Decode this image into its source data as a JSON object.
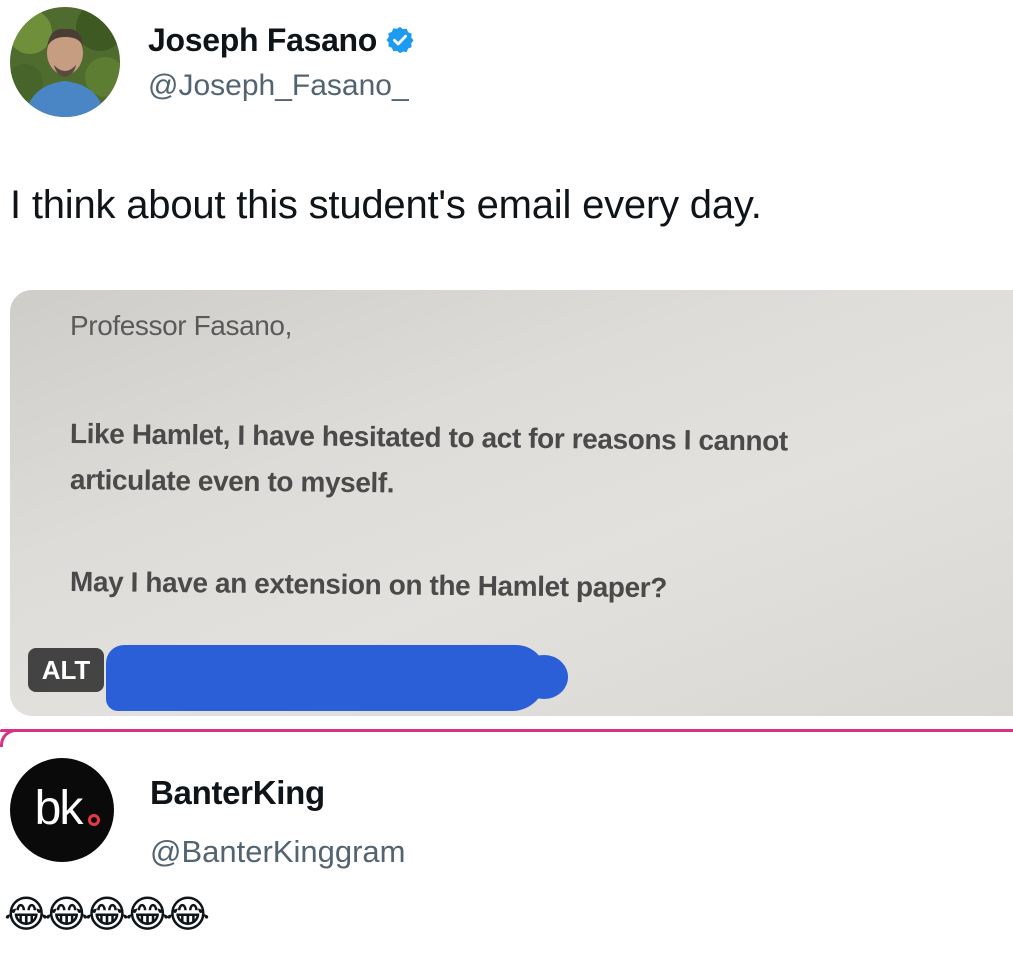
{
  "tweet": {
    "display_name": "Joseph Fasano",
    "handle": "@Joseph_Fasano_",
    "verified_icon": "verified-badge-icon",
    "text": "I think about this student's email every day."
  },
  "media": {
    "greeting": "Professor Fasano,",
    "line1": "Like Hamlet, I have hesitated to act for reasons I cannot",
    "line2": "articulate even to myself.",
    "line3": "May I have an extension on the Hamlet paper?",
    "alt_label": "ALT",
    "redaction_color": "#2b5fd8"
  },
  "reply": {
    "avatar_text": "bk",
    "display_name": "BanterKing",
    "handle": "@BanterKinggram",
    "text": "😂😂😂😂😂"
  },
  "colors": {
    "accent_divider": "#d63384",
    "verified_blue": "#1d9bf0",
    "muted_text": "#536471"
  }
}
